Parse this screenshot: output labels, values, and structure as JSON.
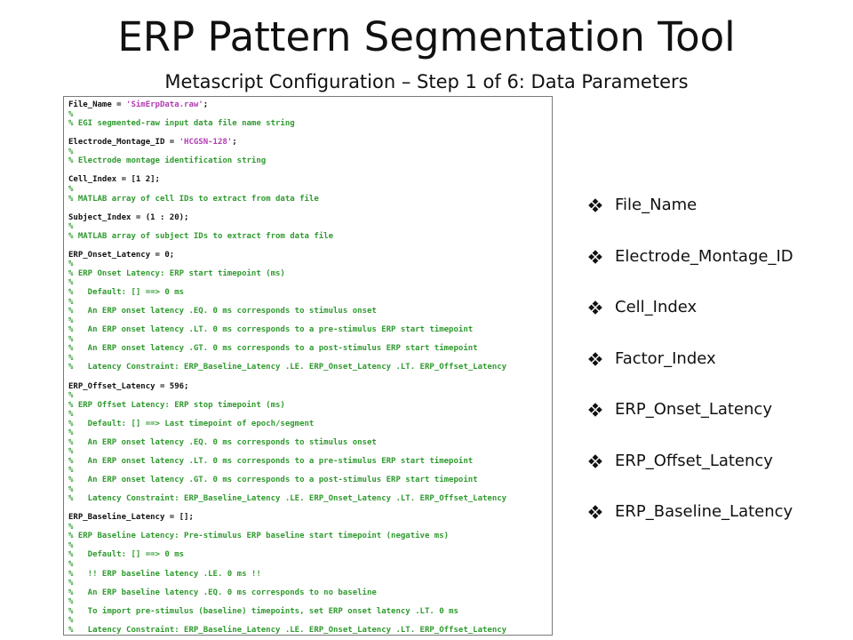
{
  "title": "ERP Pattern Segmentation Tool",
  "subtitle": "Metascript Configuration – Step 1 of 6: Data Parameters",
  "code_lines": [
    {
      "type": "code",
      "text": "File_Name = ",
      "str": "'SimErpData.raw'",
      "after": ";"
    },
    {
      "type": "comment",
      "text": "%"
    },
    {
      "type": "comment",
      "text": "% EGI segmented-raw input data file name string"
    },
    {
      "type": "blank",
      "text": ""
    },
    {
      "type": "code",
      "text": "Electrode_Montage_ID = ",
      "str": "'HCGSN-128'",
      "after": ";"
    },
    {
      "type": "comment",
      "text": "%"
    },
    {
      "type": "comment",
      "text": "% Electrode montage identification string"
    },
    {
      "type": "blank",
      "text": ""
    },
    {
      "type": "code",
      "text": "Cell_Index = [1 2];"
    },
    {
      "type": "comment",
      "text": "%"
    },
    {
      "type": "comment",
      "text": "% MATLAB array of cell IDs to extract from data file"
    },
    {
      "type": "blank",
      "text": ""
    },
    {
      "type": "code",
      "text": "Subject_Index = (1 : 20);"
    },
    {
      "type": "comment",
      "text": "%"
    },
    {
      "type": "comment",
      "text": "% MATLAB array of subject IDs to extract from data file"
    },
    {
      "type": "blank",
      "text": ""
    },
    {
      "type": "code",
      "text": "ERP_Onset_Latency = 0;"
    },
    {
      "type": "comment",
      "text": "%"
    },
    {
      "type": "comment",
      "text": "% ERP Onset Latency: ERP start timepoint (ms)"
    },
    {
      "type": "comment",
      "text": "%"
    },
    {
      "type": "comment",
      "text": "%   Default: [] ==> 0 ms"
    },
    {
      "type": "comment",
      "text": "%"
    },
    {
      "type": "comment",
      "text": "%   An ERP onset latency .EQ. 0 ms corresponds to stimulus onset"
    },
    {
      "type": "comment",
      "text": "%"
    },
    {
      "type": "comment",
      "text": "%   An ERP onset latency .LT. 0 ms corresponds to a pre-stimulus ERP start timepoint"
    },
    {
      "type": "comment",
      "text": "%"
    },
    {
      "type": "comment",
      "text": "%   An ERP onset latency .GT. 0 ms corresponds to a post-stimulus ERP start timepoint"
    },
    {
      "type": "comment",
      "text": "%"
    },
    {
      "type": "comment",
      "text": "%   Latency Constraint: ERP_Baseline_Latency .LE. ERP_Onset_Latency .LT. ERP_Offset_Latency"
    },
    {
      "type": "blank",
      "text": ""
    },
    {
      "type": "code",
      "text": "ERP_Offset_Latency = 596;"
    },
    {
      "type": "comment",
      "text": "%"
    },
    {
      "type": "comment",
      "text": "% ERP Offset Latency: ERP stop timepoint (ms)"
    },
    {
      "type": "comment",
      "text": "%"
    },
    {
      "type": "comment",
      "text": "%   Default: [] ==> Last timepoint of epoch/segment"
    },
    {
      "type": "comment",
      "text": "%"
    },
    {
      "type": "comment",
      "text": "%   An ERP onset latency .EQ. 0 ms corresponds to stimulus onset"
    },
    {
      "type": "comment",
      "text": "%"
    },
    {
      "type": "comment",
      "text": "%   An ERP onset latency .LT. 0 ms corresponds to a pre-stimulus ERP start timepoint"
    },
    {
      "type": "comment",
      "text": "%"
    },
    {
      "type": "comment",
      "text": "%   An ERP onset latency .GT. 0 ms corresponds to a post-stimulus ERP start timepoint"
    },
    {
      "type": "comment",
      "text": "%"
    },
    {
      "type": "comment",
      "text": "%   Latency Constraint: ERP_Baseline_Latency .LE. ERP_Onset_Latency .LT. ERP_Offset_Latency"
    },
    {
      "type": "blank",
      "text": ""
    },
    {
      "type": "code",
      "text": "ERP_Baseline_Latency = [];"
    },
    {
      "type": "comment",
      "text": "%"
    },
    {
      "type": "comment",
      "text": "% ERP Baseline Latency: Pre-stimulus ERP baseline start timepoint (negative ms)"
    },
    {
      "type": "comment",
      "text": "%"
    },
    {
      "type": "comment",
      "text": "%   Default: [] ==> 0 ms"
    },
    {
      "type": "comment",
      "text": "%"
    },
    {
      "type": "comment",
      "text": "%   !! ERP baseline latency .LE. 0 ms !!"
    },
    {
      "type": "comment",
      "text": "%"
    },
    {
      "type": "comment",
      "text": "%   An ERP baseline latency .EQ. 0 ms corresponds to no baseline"
    },
    {
      "type": "comment",
      "text": "%"
    },
    {
      "type": "comment",
      "text": "%   To import pre-stimulus (baseline) timepoints, set ERP onset latency .LT. 0 ms"
    },
    {
      "type": "comment",
      "text": "%"
    },
    {
      "type": "comment",
      "text": "%   Latency Constraint: ERP_Baseline_Latency .LE. ERP_Onset_Latency .LT. ERP_Offset_Latency"
    }
  ],
  "bullets": [
    "File_Name",
    "Electrode_Montage_ID",
    "Cell_Index",
    "Factor_Index",
    "ERP_Onset_Latency",
    "ERP_Offset_Latency",
    "ERP_Baseline_Latency"
  ],
  "bullet_icon": "four-diamond-bullet-icon",
  "colors": {
    "comment": "#2f9a2f",
    "string": "#b23bb2",
    "code": "#111111"
  }
}
